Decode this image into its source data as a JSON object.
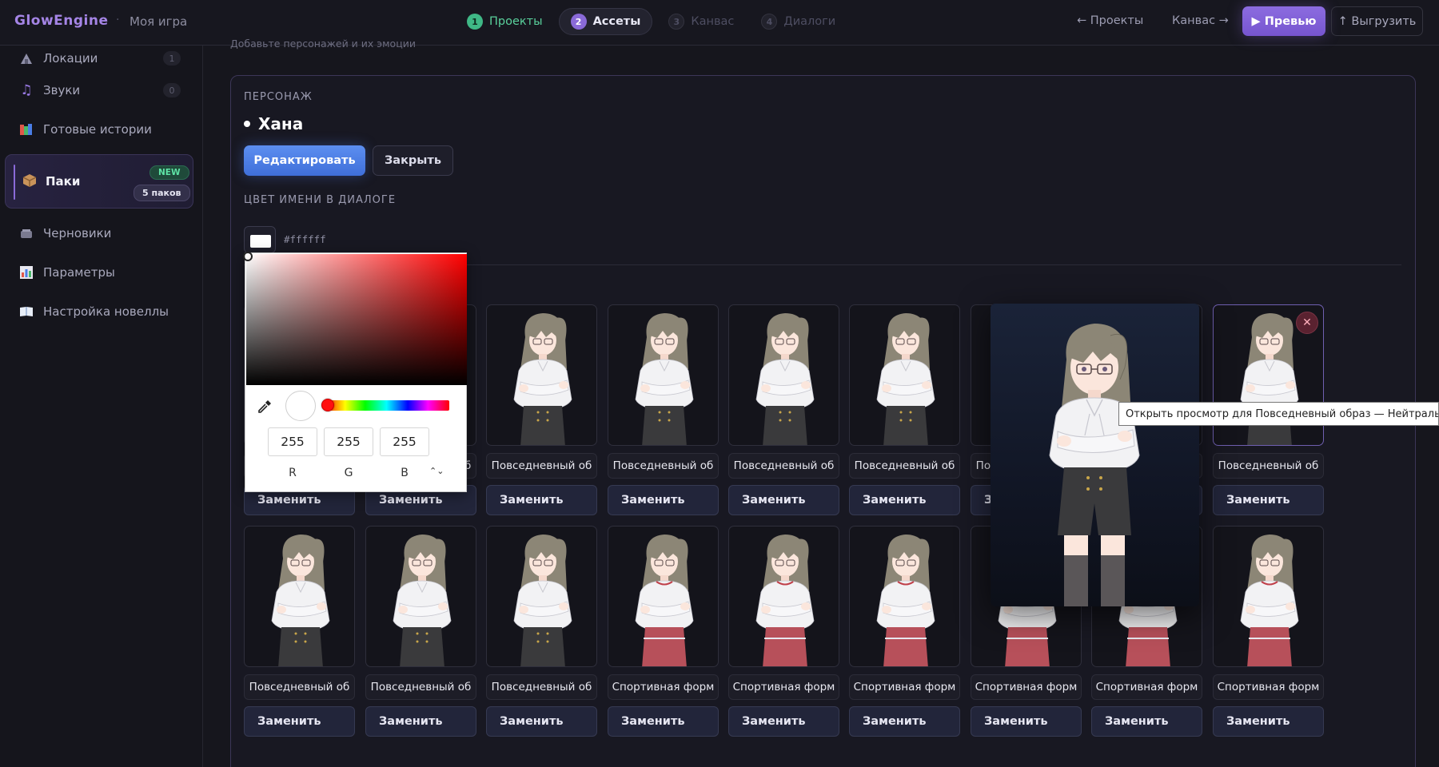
{
  "header": {
    "brand": "GlowEngine",
    "separator": "·",
    "project": "Моя игра",
    "steps": [
      {
        "num": "1",
        "label": "Проекты",
        "state": "done"
      },
      {
        "num": "2",
        "label": "Ассеты",
        "state": "active"
      },
      {
        "num": "3",
        "label": "Канвас",
        "state": "disabled"
      },
      {
        "num": "4",
        "label": "Диалоги",
        "state": "disabled"
      }
    ],
    "back_link": "← Проекты",
    "next_link": "Канвас →",
    "preview_label": "▶ Превью",
    "export_label": "↑ Выгрузить"
  },
  "sidebar": {
    "items": [
      {
        "label": "Локации",
        "count": "1",
        "icon": "location-icon"
      },
      {
        "label": "Звуки",
        "count": "0",
        "icon": "music-note-icon"
      },
      {
        "label": "Готовые истории",
        "icon": "books-icon"
      },
      {
        "label": "Черновики",
        "icon": "drafts-icon"
      },
      {
        "label": "Параметры",
        "icon": "chart-icon"
      },
      {
        "label": "Настройка новеллы",
        "icon": "book-icon"
      }
    ],
    "packs": {
      "label": "Паки",
      "badge_new": "NEW",
      "badge_count": "5 паков",
      "icon": "package-icon"
    }
  },
  "main": {
    "hint": "Добавьте персонажей и их эмоции",
    "section_character": "ПЕРСОНАЖ",
    "character_name": "Хана",
    "edit_label": "Редактировать",
    "close_label": "Закрыть",
    "section_color": "ЦВЕТ ИМЕНИ В ДИАЛОГЕ",
    "color_value": "#ffffff"
  },
  "picker": {
    "r": "255",
    "g": "255",
    "b": "255",
    "r_label": "R",
    "g_label": "G",
    "b_label": "B",
    "toggle": "⌃⌄"
  },
  "grid": {
    "replace_label": "Заменить",
    "row1": [
      "Повседневный об",
      "Повседневный об",
      "Повседневный об",
      "Повседневный об",
      "Повседневный об",
      "Повседневный об",
      "Повседневный об",
      "Повседневный об",
      "Повседневный об"
    ],
    "row2": [
      "Повседневный об",
      "Повседневный об",
      "Повседневный об",
      "Спортивная форм",
      "Спортивная форм",
      "Спортивная форм",
      "Спортивная форм",
      "Спортивная форм",
      "Спортивная форм"
    ]
  },
  "tooltip": "Открыть просмотр для Повседневный образ — Нейтрально",
  "colors": {
    "accent": "#8a6ad8",
    "primary_button": "#4a7de6",
    "success": "#3fb886",
    "background": "#16161d"
  }
}
